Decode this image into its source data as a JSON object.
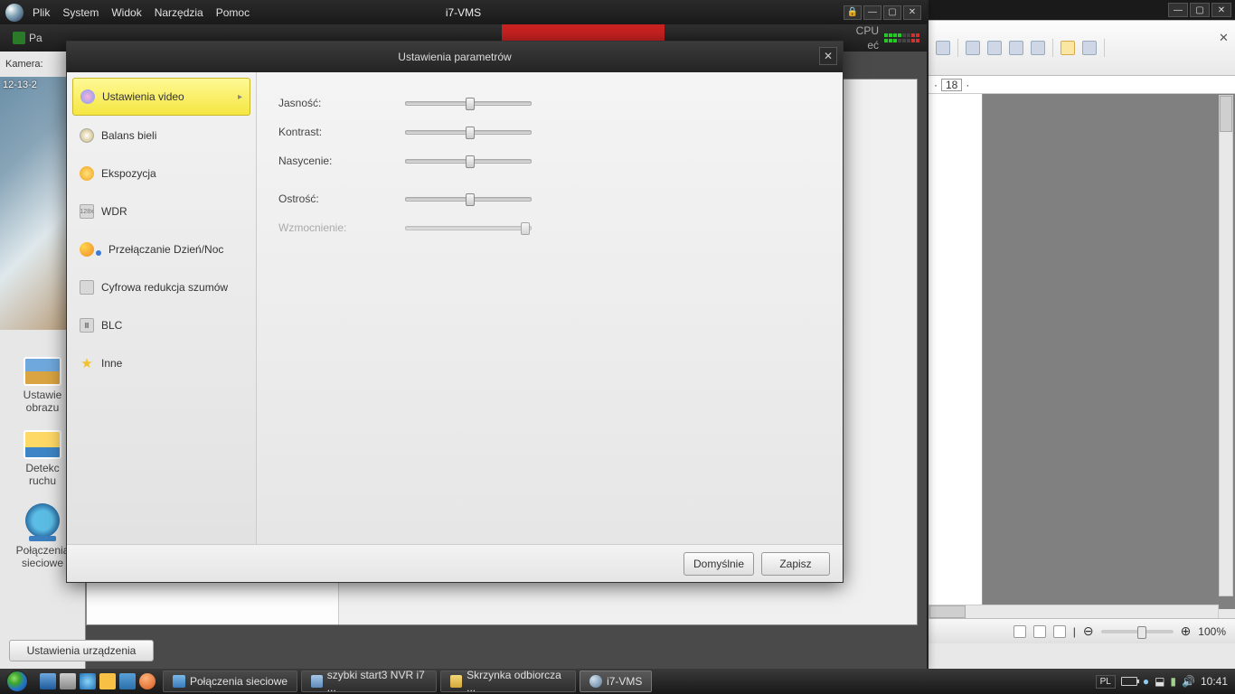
{
  "vms": {
    "title": "i7-VMS",
    "menu": [
      "Plik",
      "System",
      "Widok",
      "Narzędzia",
      "Pomoc"
    ],
    "tab_label": "Pa",
    "cpu_label": "CPU",
    "net_label": "eć",
    "left": {
      "kamera": "Kamera:",
      "timestamp": "12-13-2",
      "ustawienia_obrazu": "Ustawie\nobrazu",
      "detekcja": "Detekc\nruchu",
      "polaczenia": "Połączenia\nsieciowe"
    },
    "bottom_btn": "Ustawienia urządzenia"
  },
  "dialog": {
    "title": "Ustawienia parametrów",
    "sidebar": {
      "video": "Ustawienia video",
      "balans": "Balans bieli",
      "ekspozycja": "Ekspozycja",
      "wdr": "WDR",
      "daynight": "Przełączanie Dzień/Noc",
      "dnr": "Cyfrowa redukcja szumów",
      "blc": "BLC",
      "inne": "Inne"
    },
    "params": {
      "jasnosc": "Jasność:",
      "kontrast": "Kontrast:",
      "nasycenie": "Nasycenie:",
      "ostrosc": "Ostrość:",
      "wzmocnienie": "Wzmocnienie:"
    },
    "sliders": {
      "jasnosc": 50,
      "kontrast": 50,
      "nasycenie": 50,
      "ostrosc": 50,
      "wzmocnienie": 100
    },
    "btn_default": "Domyślnie",
    "btn_save": "Zapisz"
  },
  "bg": {
    "ruler_value": "18",
    "zoom": "100%"
  },
  "taskbar": {
    "items": [
      "Połączenia sieciowe",
      "szybki start3 NVR i7 ...",
      "Skrzynka odbiorcza ...",
      "i7-VMS"
    ],
    "lang": "PL",
    "clock": "10:41"
  }
}
